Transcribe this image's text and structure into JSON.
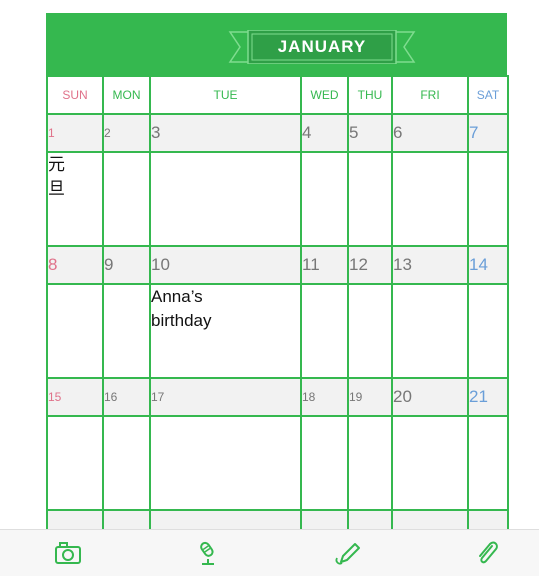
{
  "month": "JANUARY",
  "days_of_week": [
    "SUN",
    "MON",
    "TUE",
    "WED",
    "THU",
    "FRI",
    "SAT"
  ],
  "weeks": [
    {
      "days": [
        "1",
        "2",
        "3",
        "4",
        "5",
        "6",
        "7"
      ],
      "events": [
        "元旦",
        "",
        "",
        "",
        "",
        "",
        ""
      ]
    },
    {
      "days": [
        "8",
        "9",
        "10",
        "11",
        "12",
        "13",
        "14"
      ],
      "events": [
        "",
        "",
        "Anna’s birthday",
        "",
        "",
        "",
        ""
      ]
    },
    {
      "days": [
        "15",
        "16",
        "17",
        "18",
        "19",
        "20",
        "21"
      ],
      "events": [
        "",
        "",
        "",
        "",
        "",
        "",
        ""
      ]
    }
  ],
  "tabbar": {
    "items": [
      {
        "icon": "camera-icon"
      },
      {
        "icon": "microphone-icon"
      },
      {
        "icon": "pen-icon"
      },
      {
        "icon": "paperclip-icon"
      }
    ]
  },
  "colors": {
    "accent": "#35b84f",
    "sunday": "#e0728a",
    "saturday": "#6a9ed8",
    "number_row_bg": "#f2f2f2"
  }
}
